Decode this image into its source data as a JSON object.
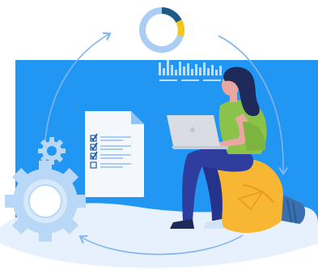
{
  "illustration": {
    "subject": "woman-with-laptop-on-lightbulb",
    "icons": [
      "donut-chart-icon",
      "bar-chart-icon",
      "checklist-document-icon",
      "laptop-icon",
      "lightbulb-icon",
      "gear-icon",
      "small-gear-icon",
      "cycle-arrow-icon"
    ],
    "donut_chart": {
      "segments": [
        0.62,
        0.1,
        0.28
      ]
    },
    "checklist": {
      "checked": 3,
      "total": 4
    },
    "colors": {
      "background_panel": "#2196F3",
      "arrow": "#7FB5F0",
      "ground": "#E6F1FD",
      "donut_dark": "#1E5A85",
      "donut_yellow": "#F5C518",
      "donut_light": "#A9CDF3",
      "shirt": "#8BC34A",
      "pants": "#2F3E9E",
      "hair": "#1D2A5A",
      "skin": "#E8A7A0",
      "bulb": "#F7B733",
      "bulb_base": "#3A6FB0",
      "laptop": "#D9DDE3",
      "gear": "#B9D7F7",
      "document": "#F4F8FD",
      "check": "#1E5EAA"
    }
  }
}
